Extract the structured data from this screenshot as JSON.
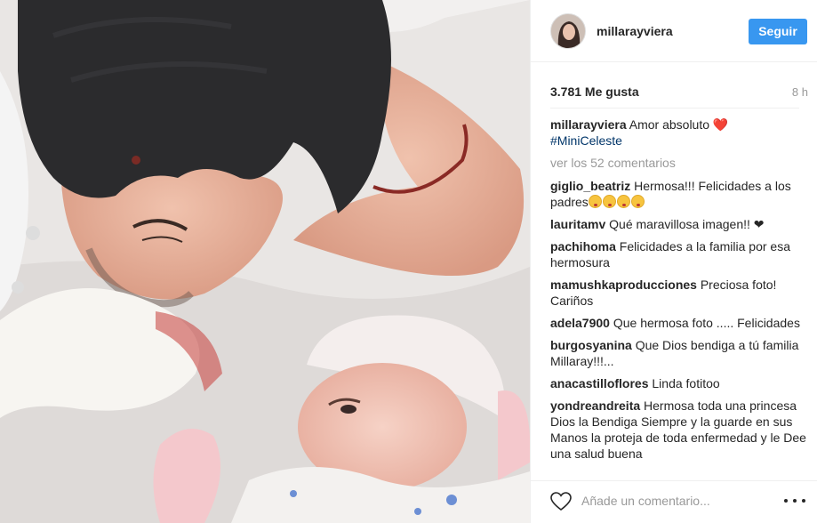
{
  "post": {
    "photo_alt": "",
    "author": {
      "username": "millarayviera"
    },
    "follow_label": "Seguir",
    "likes": "3.781 Me gusta",
    "time_ago": "8 h",
    "caption": {
      "user": "millarayviera",
      "text": "Amor absoluto",
      "emoji": "❤️",
      "hashtag": "#MiniCeleste"
    },
    "view_all": "ver los 52 comentarios",
    "comments": [
      {
        "user": "giglio_beatriz",
        "text": "Hermosa!!! Felicidades a los padres",
        "emoji_count": 4
      },
      {
        "user": "lauritamv",
        "text": "Qué maravillosa imagen!! ❤"
      },
      {
        "user": "pachihoma",
        "text": "Felicidades a la familia por esa hermosura"
      },
      {
        "user": "mamushkaproducciones",
        "text": "Preciosa foto! Cariños"
      },
      {
        "user": "adela7900",
        "text": "Que hermosa foto ..... Felicidades"
      },
      {
        "user": "burgosyanina",
        "text": "Que Dios bendiga a tú familia Millaray!!!..."
      },
      {
        "user": "anacastilloflores",
        "text": "Linda fotitoo"
      },
      {
        "user": "yondreandreita",
        "text": "Hermosa toda una princesa Dios la Bendiga Siempre y la guarde en sus Manos la proteja de toda enfermedad y le Dee una salud buena"
      }
    ],
    "comment_placeholder": "Añade un comentario...",
    "icons": {
      "like": "heart-outline-icon",
      "more": "more-options-icon"
    },
    "colors": {
      "accent": "#3897f0",
      "hashtag": "#003569",
      "muted": "#999999"
    }
  }
}
